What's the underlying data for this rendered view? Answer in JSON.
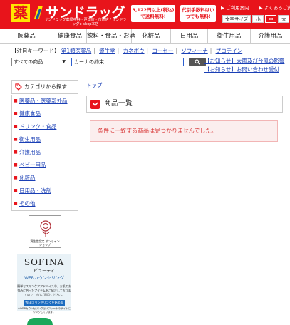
{
  "header": {
    "logo_kanji": "薬",
    "logo_text": "サンドラッグ",
    "logo_sub": "サンドラッグ薬局中谷・戸田店・市川店 / サンドラッグe-shop本店",
    "promo_free_shipping": "3,122円以上(税込)で送料無料!",
    "promo_cod": "代引手数料はいつでも無料!",
    "links": [
      "ご利用案内",
      "よくあるご質問"
    ],
    "font_size_label": "文字サイズ",
    "font_sizes": [
      "小",
      "中",
      "大"
    ],
    "font_size_active": "中"
  },
  "categories": [
    "医薬品",
    "健康食品",
    "飲料・食品・お酒",
    "化粧品",
    "日用品",
    "衛生用品",
    "介護用品"
  ],
  "keywords": {
    "label": "【注目キーワード】",
    "items": [
      "第1類医薬品",
      "資生堂",
      "カネボウ",
      "コーセー",
      "ソフィーナ",
      "プロテイン"
    ]
  },
  "search": {
    "scope": "すべての商品",
    "query": "カーナの約束"
  },
  "notices": [
    "【お知らせ】大雨及び台風の影響",
    "【お知らせ】お問い合わせ受付"
  ],
  "sidebar": {
    "heading": "カテゴリから探す",
    "items": [
      "医薬品・医薬部外品",
      "健康食品",
      "ドリンク・食品",
      "衛生用品",
      "介護用品",
      "ベビー用品",
      "化粧品",
      "日用品・洗剤",
      "その他"
    ],
    "badge_text": "資生堂認定 オンラインショップ",
    "sofina": {
      "title": "SOFINA",
      "subtitle": "ビューティ",
      "service": "WEBカウンセリング",
      "desc": "簡単なスキンケアアドバイスや、お肌のお悩みに合ったアイテムをご紹介しておりますので、ぜひご利用ください。",
      "button": "WEBカウンセリングを始める",
      "note": "※WEBカウンセリングはソフィーナのサイトにリンクしています。"
    }
  },
  "main": {
    "breadcrumb": "トップ",
    "section_title": "商品一覧",
    "empty_message": "条件に一致する商品は見つかりませんでした。"
  },
  "colors": {
    "brand_red": "#e8141b",
    "logo_yellow": "#ffe600",
    "link_blue": "#1a3fb5"
  }
}
